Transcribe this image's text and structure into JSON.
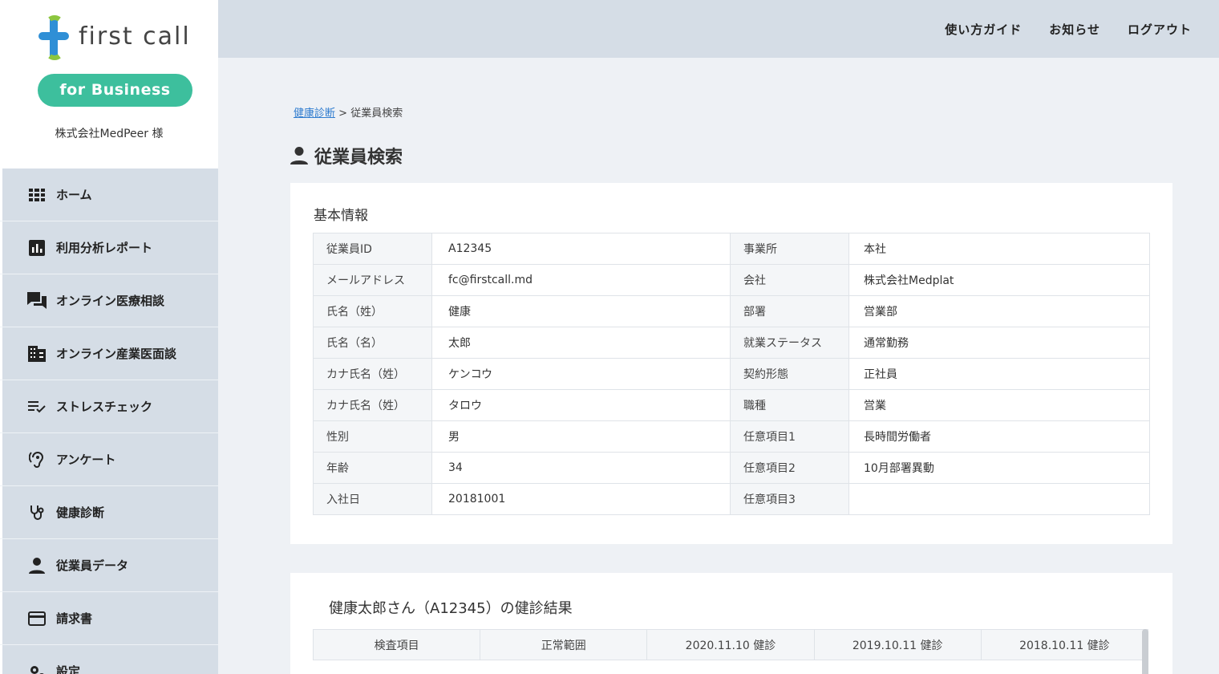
{
  "brand": {
    "logo_text": "first call",
    "business_label": "for Business",
    "company": "株式会社MedPeer 様",
    "colors": {
      "green": "#3dbf9d",
      "blue": "#2f8fd6",
      "lime": "#8cc63f"
    }
  },
  "topnav": [
    "使い方ガイド",
    "お知らせ",
    "ログアウト"
  ],
  "sidebar": {
    "items": [
      {
        "label": "ホーム",
        "icon": "grid-icon"
      },
      {
        "label": "利用分析レポート",
        "icon": "bar-chart-icon"
      },
      {
        "label": "オンライン医療相談",
        "icon": "chat-bubbles-icon"
      },
      {
        "label": "オンライン産業医面談",
        "icon": "building-icon"
      },
      {
        "label": "ストレスチェック",
        "icon": "checklist-icon"
      },
      {
        "label": "アンケート",
        "icon": "ear-icon"
      },
      {
        "label": "健康診断",
        "icon": "stethoscope-icon"
      },
      {
        "label": "従業員データ",
        "icon": "person-icon"
      },
      {
        "label": "請求書",
        "icon": "credit-card-icon"
      },
      {
        "label": "設定",
        "icon": "gears-icon"
      }
    ]
  },
  "breadcrumb": {
    "link": "健康診断",
    "separator": ">",
    "current": "従業員検索"
  },
  "page_title": "従業員検索",
  "basic_info": {
    "title": "基本情報",
    "rows": [
      [
        "従業員ID",
        "A12345",
        "事業所",
        "本社"
      ],
      [
        "メールアドレス",
        "fc@firstcall.md",
        "会社",
        "株式会社Medplat"
      ],
      [
        "氏名（姓）",
        "健康",
        "部署",
        "営業部"
      ],
      [
        "氏名（名）",
        "太郎",
        "就業ステータス",
        "通常勤務"
      ],
      [
        "カナ氏名（姓）",
        "ケンコウ",
        "契約形態",
        "正社員"
      ],
      [
        "カナ氏名（姓）",
        "タロウ",
        "職種",
        "営業"
      ],
      [
        "性別",
        "男",
        "任意項目1",
        "長時間労働者"
      ],
      [
        "年齢",
        "34",
        "任意項目2",
        "10月部署異動"
      ],
      [
        "入社日",
        "20181001",
        "任意項目3",
        ""
      ]
    ]
  },
  "results": {
    "title": "健康太郎さん（A12345）の健診結果",
    "headers": [
      "検査項目",
      "正常範囲",
      "2020.11.10 健診",
      "2019.10.11 健診",
      "2018.10.11 健診"
    ]
  }
}
